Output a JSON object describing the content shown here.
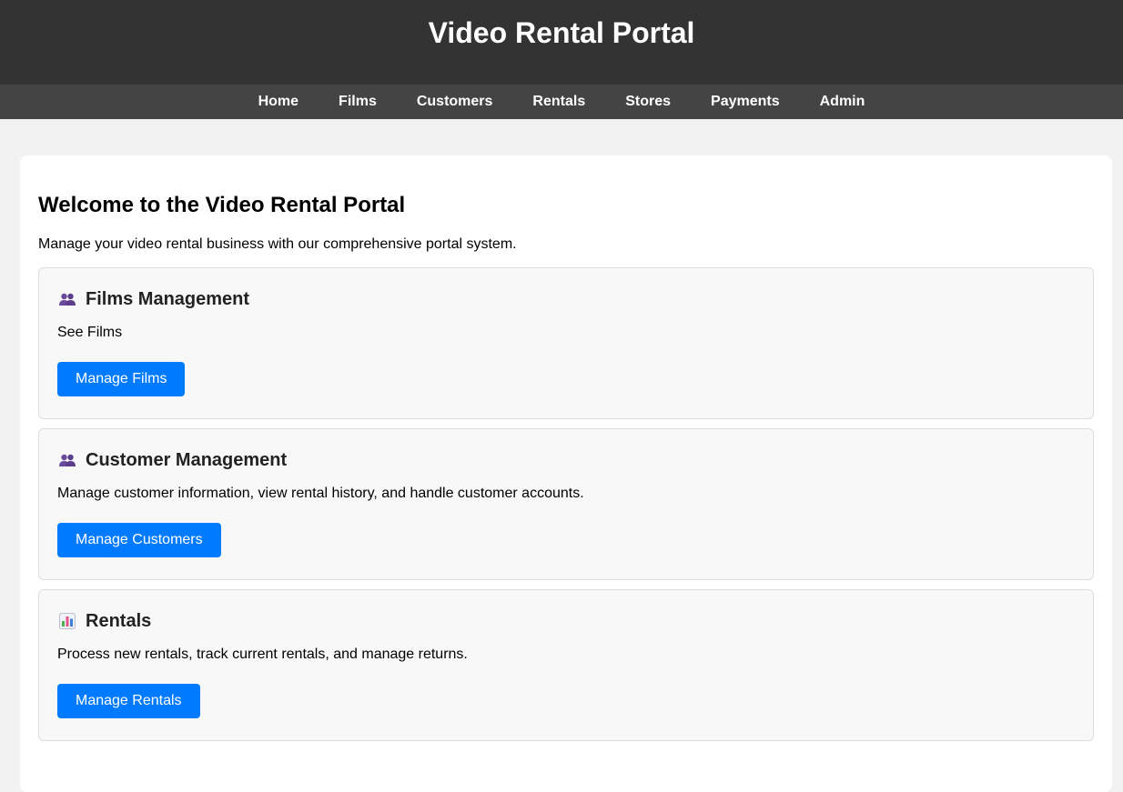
{
  "header": {
    "title": "Video Rental Portal"
  },
  "nav": {
    "items": [
      "Home",
      "Films",
      "Customers",
      "Rentals",
      "Stores",
      "Payments",
      "Admin"
    ]
  },
  "main": {
    "heading": "Welcome to the Video Rental Portal",
    "intro": "Manage your video rental business with our comprehensive portal system.",
    "cards": [
      {
        "icon": "users-icon",
        "title": "Films Management",
        "description": "See Films",
        "button": "Manage Films"
      },
      {
        "icon": "users-icon",
        "title": "Customer Management",
        "description": "Manage customer information, view rental history, and handle customer accounts.",
        "button": "Manage Customers"
      },
      {
        "icon": "bar-chart-icon",
        "title": "Rentals",
        "description": "Process new rentals, track current rentals, and manage returns.",
        "button": "Manage Rentals"
      }
    ]
  },
  "colors": {
    "header_bg": "#333333",
    "nav_bg": "#444444",
    "button_bg": "#007bff",
    "page_bg": "#f2f2f2"
  }
}
